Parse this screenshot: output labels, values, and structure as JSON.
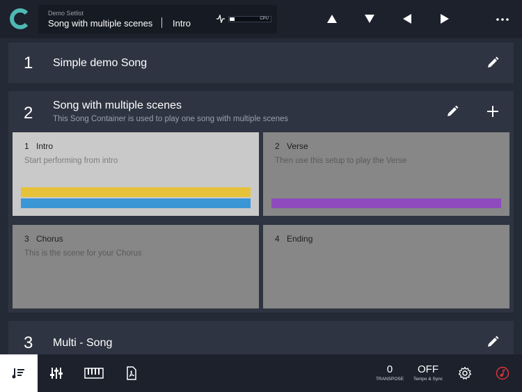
{
  "header": {
    "setlist": "Demo Setlist",
    "current_song": "Song with multiple scenes",
    "current_scene": "Intro",
    "cpu_label": "CPU",
    "cpu_load": 0.12
  },
  "songs": [
    {
      "number": "1",
      "title": "Simple demo Song"
    },
    {
      "number": "2",
      "title": "Song with multiple scenes",
      "description": "This Song Container is used to play one song with multiple scenes",
      "scenes": [
        {
          "number": "1",
          "title": "Intro",
          "description": "Start performing from intro",
          "active": true,
          "colors": [
            "#e6c23a",
            "#3b96d6"
          ]
        },
        {
          "number": "2",
          "title": "Verse",
          "description": "Then use this setup to play the Verse",
          "active": false,
          "colors": [
            "#8e4bbd"
          ]
        },
        {
          "number": "3",
          "title": "Chorus",
          "description": "This is the scene for your Chorus",
          "active": false,
          "colors": []
        },
        {
          "number": "4",
          "title": "Ending",
          "description": "",
          "active": false,
          "colors": []
        }
      ]
    },
    {
      "number": "3",
      "title": "Multi - Song"
    }
  ],
  "footer": {
    "transpose_value": "0",
    "transpose_label": "TRANSPOSE",
    "tempo_value": "OFF",
    "tempo_label": "Tempo & Sync",
    "tabs": [
      "setlist-icon",
      "mixer-icon",
      "keyboard-icon",
      "pdf-icon"
    ]
  },
  "colors": {
    "accent": "#4fb9b3",
    "record": "#d8353a"
  }
}
